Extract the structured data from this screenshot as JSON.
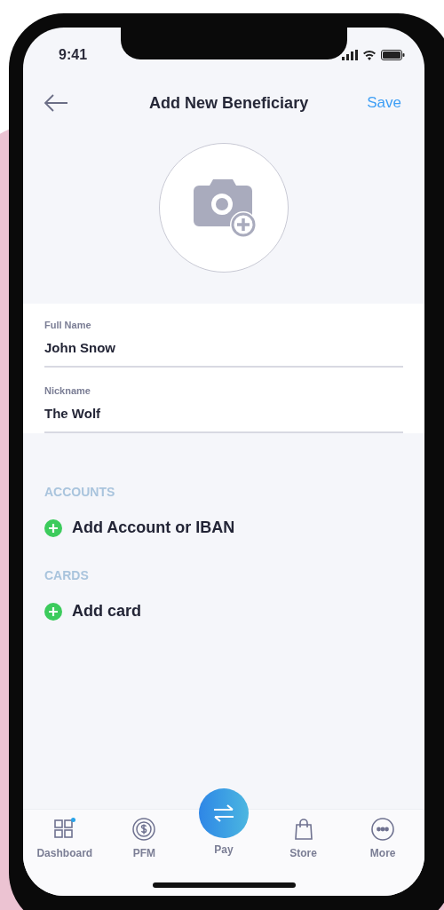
{
  "status_bar": {
    "time": "9:41"
  },
  "header": {
    "title": "Add New Beneficiary",
    "action": "Save"
  },
  "form": {
    "fields": [
      {
        "label": "Full Name",
        "value": "John Snow"
      },
      {
        "label": "Nickname",
        "value": "The Wolf"
      }
    ]
  },
  "sections": [
    {
      "heading": "ACCOUNTS",
      "action": "Add Account or IBAN"
    },
    {
      "heading": "CARDS",
      "action": "Add card"
    }
  ],
  "tab_bar": [
    {
      "label": "Dashboard",
      "kind": "grid",
      "dot": true
    },
    {
      "label": "PFM",
      "kind": "coin",
      "dot": false
    },
    {
      "label": "Pay",
      "kind": "center",
      "dot": false
    },
    {
      "label": "Store",
      "kind": "bag",
      "dot": false
    },
    {
      "label": "More",
      "kind": "more",
      "dot": false
    }
  ]
}
